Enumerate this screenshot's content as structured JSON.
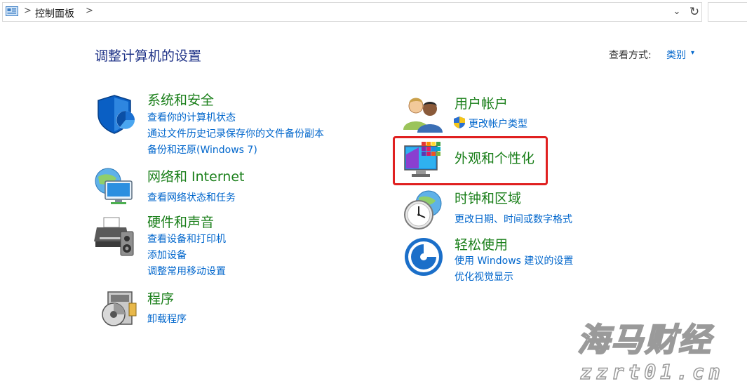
{
  "address_bar": {
    "breadcrumb": "控制面板",
    "separator": ">",
    "dropdown_glyph": "⌄",
    "refresh_glyph": "↻"
  },
  "header": {
    "title": "调整计算机的设置",
    "view_by_label": "查看方式:",
    "view_by_value": "类别",
    "view_by_caret": "▾"
  },
  "left_categories": [
    {
      "title": "系统和安全",
      "icon": "shield-icon",
      "links": [
        "查看你的计算机状态",
        "通过文件历史记录保存你的文件备份副本",
        "备份和还原(Windows 7)"
      ]
    },
    {
      "title": "网络和 Internet",
      "icon": "network-globe-icon",
      "links": [
        "查看网络状态和任务"
      ]
    },
    {
      "title": "硬件和声音",
      "icon": "printer-speaker-icon",
      "links": [
        "查看设备和打印机",
        "添加设备",
        "调整常用移动设置"
      ]
    },
    {
      "title": "程序",
      "icon": "programs-disc-icon",
      "links": [
        "卸载程序"
      ]
    }
  ],
  "right_categories": [
    {
      "title": "用户帐户",
      "icon": "users-icon",
      "links": [
        "更改帐户类型"
      ]
    },
    {
      "title": "外观和个性化",
      "icon": "appearance-monitor-icon",
      "links": []
    },
    {
      "title": "时钟和区域",
      "icon": "clock-globe-icon",
      "links": [
        "更改日期、时间或数字格式"
      ]
    },
    {
      "title": "轻松使用",
      "icon": "ease-of-access-icon",
      "links": [
        "使用 Windows 建议的设置",
        "优化视觉显示"
      ]
    }
  ],
  "watermark": {
    "big_text": "海马财经",
    "small_text": "zzrt01.cn"
  },
  "colors": {
    "category_title": "#1a7f1a",
    "link": "#0066cc",
    "page_title": "#1e3287",
    "highlight": "#e02020"
  }
}
